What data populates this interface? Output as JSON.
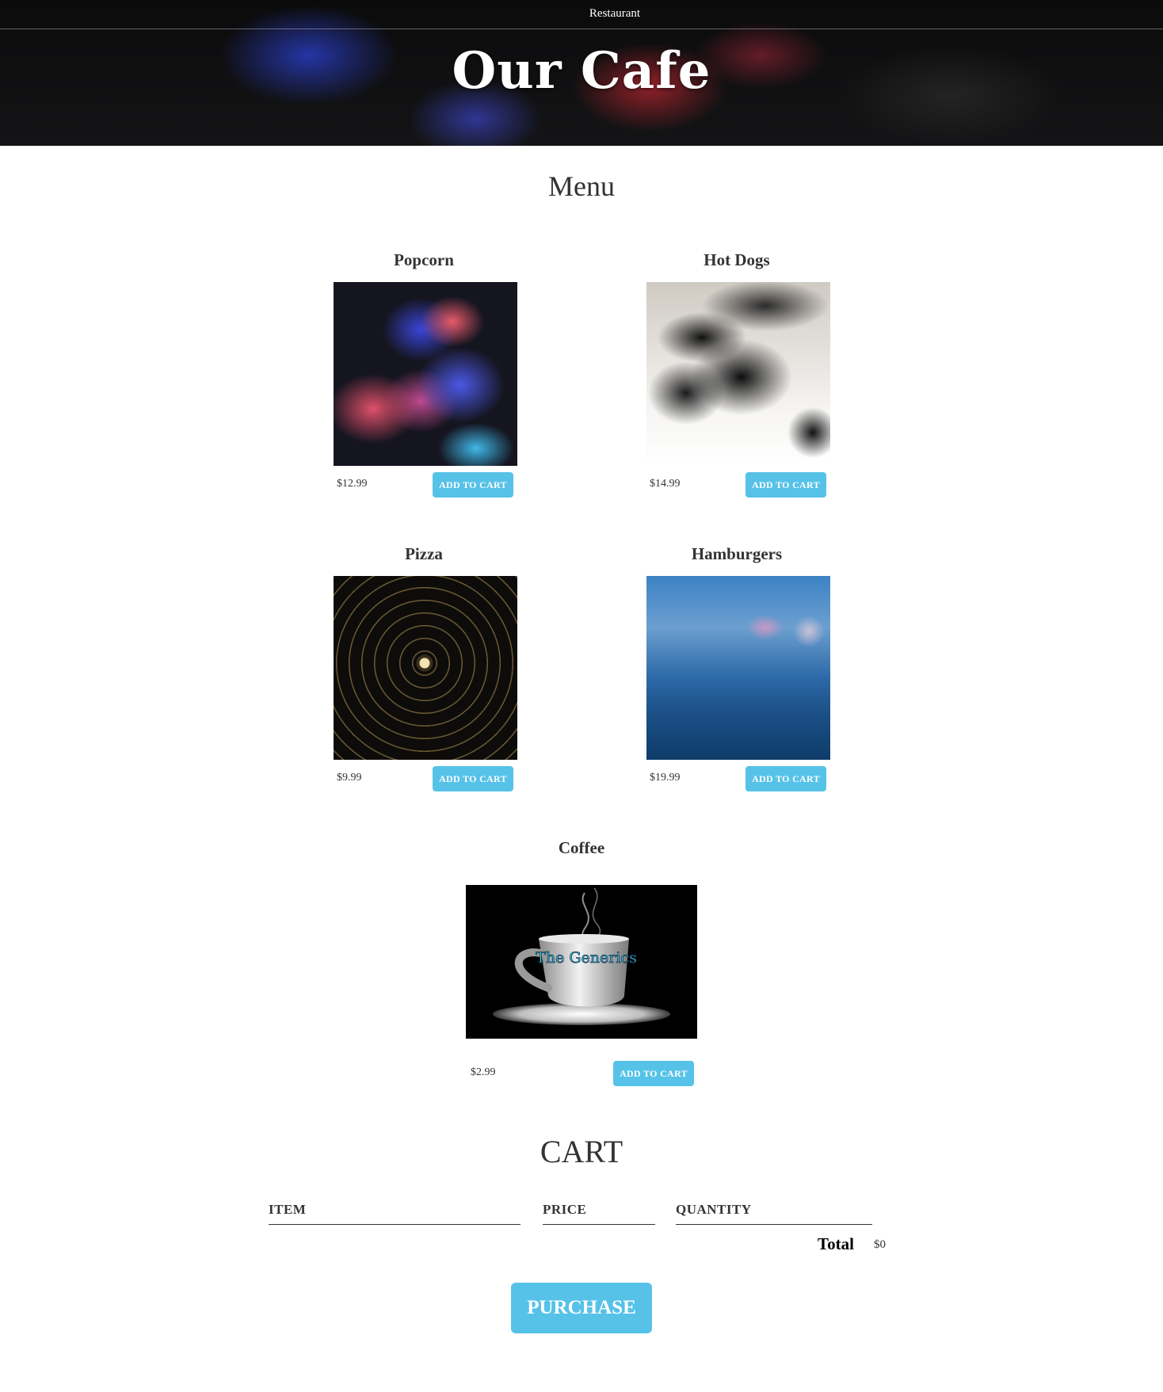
{
  "nav": {
    "restaurant_link": "Restaurant"
  },
  "site": {
    "title": "Our Cafe"
  },
  "menu": {
    "title": "Menu",
    "add_label": "ADD TO CART",
    "items": [
      {
        "name": "Popcorn",
        "price": "$12.99",
        "image": "colorful-smoke-image"
      },
      {
        "name": "Hot Dogs",
        "price": "$14.99",
        "image": "black-ink-smoke-image"
      },
      {
        "name": "Pizza",
        "price": "$9.99",
        "image": "radial-light-dome-image"
      },
      {
        "name": "Hamburgers",
        "price": "$19.99",
        "image": "blue-bokeh-road-image"
      },
      {
        "name": "Coffee",
        "price": "$2.99",
        "image": "coffee-cup-image",
        "cup_text": "The Generics"
      }
    ]
  },
  "cart": {
    "title": "CART",
    "columns": [
      "ITEM",
      "PRICE",
      "QUANTITY"
    ],
    "total_label": "Total",
    "total_value": "$0",
    "purchase_label": "PURCHASE"
  },
  "colors": {
    "accent": "#56c2e8",
    "text": "#333333",
    "header_bg": "#0b0b0c"
  }
}
